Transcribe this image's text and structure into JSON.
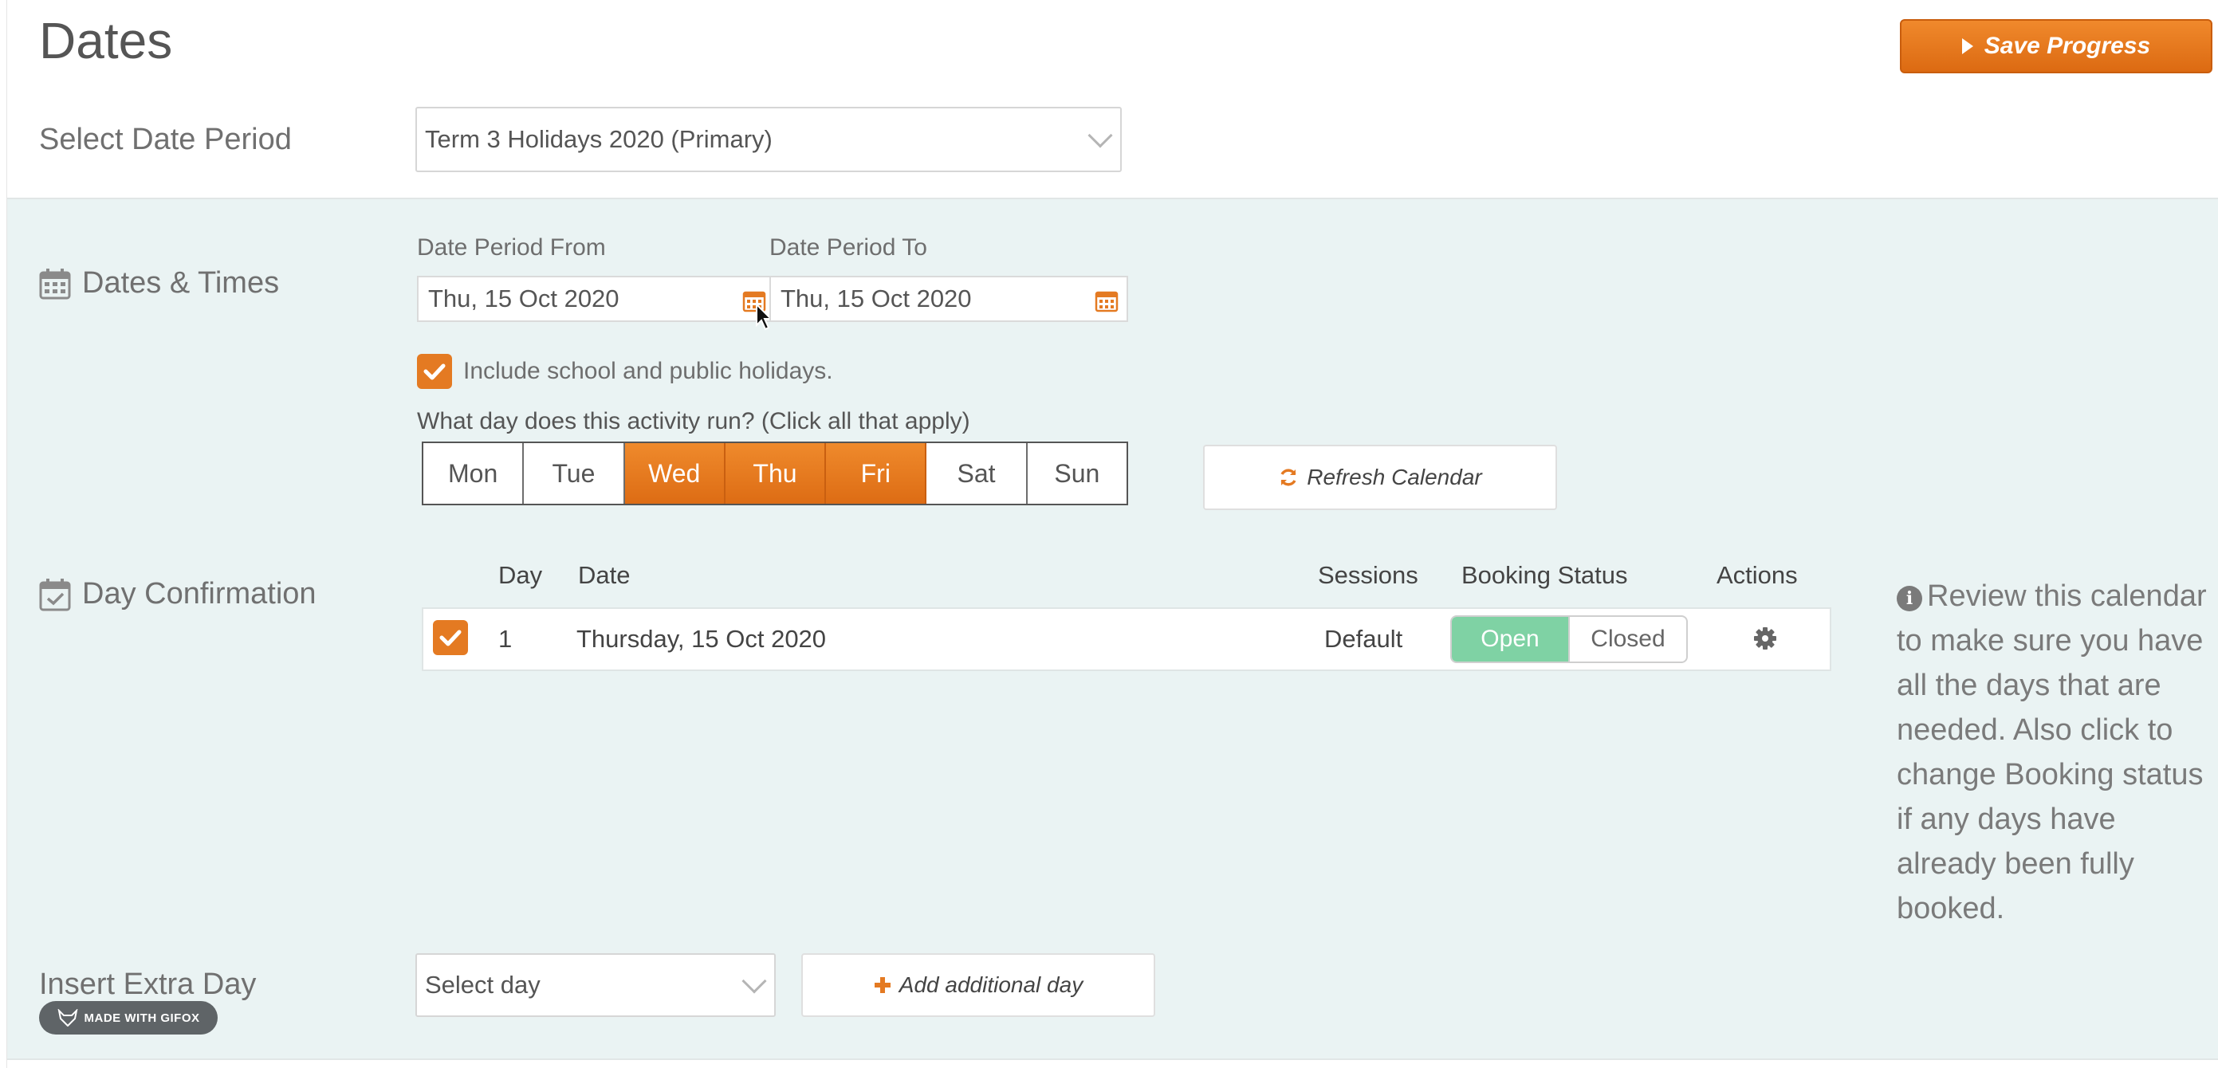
{
  "page": {
    "title": "Dates"
  },
  "toolbar": {
    "save_label": "Save Progress"
  },
  "date_period": {
    "label": "Select Date Period",
    "selected": "Term 3 Holidays 2020 (Primary)"
  },
  "dates_times": {
    "label": "Dates & Times",
    "from_label": "Date Period From",
    "from_value": "Thu, 15 Oct 2020",
    "to_label": "Date Period To",
    "to_value": "Thu, 15 Oct 2020",
    "include_holidays_label": "Include school and public holidays.",
    "include_holidays_checked": true,
    "days_question": "What day does this activity run? (Click all that apply)",
    "days": [
      {
        "label": "Mon",
        "selected": false
      },
      {
        "label": "Tue",
        "selected": false
      },
      {
        "label": "Wed",
        "selected": true
      },
      {
        "label": "Thu",
        "selected": true
      },
      {
        "label": "Fri",
        "selected": true
      },
      {
        "label": "Sat",
        "selected": false
      },
      {
        "label": "Sun",
        "selected": false
      }
    ],
    "refresh_label": "Refresh Calendar"
  },
  "day_confirmation": {
    "label": "Day Confirmation",
    "columns": [
      "Day",
      "Date",
      "Sessions",
      "Booking Status",
      "Actions"
    ],
    "rows": [
      {
        "checked": true,
        "day": "1",
        "date": "Thursday, 15 Oct 2020",
        "sessions": "Default",
        "status_open": "Open",
        "status_closed": "Closed",
        "status_selected": "Open"
      }
    ],
    "info_text": "Review this calendar to make sure you have all the days that are needed. Also click to change Booking status if any days have already been fully booked."
  },
  "extra_day": {
    "label": "Insert Extra Day",
    "select_placeholder": "Select day",
    "add_label": "Add additional day"
  },
  "watermark": {
    "text": "MADE WITH GIFOX"
  },
  "colors": {
    "accent": "#e47a22",
    "open_green": "#7fd2a4",
    "band": "#eaf3f3"
  }
}
